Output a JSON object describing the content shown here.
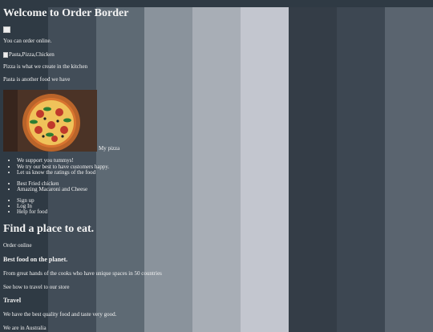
{
  "page": {
    "title": "Welcome to Order Border",
    "stripe_colors": [
      "#2f3a44",
      "#424d58",
      "#5e6a74",
      "#8a939c",
      "#a8aeb6",
      "#c3c6cf",
      "#343d47",
      "#3d4752",
      "#5a646f"
    ]
  },
  "intro": {
    "broken_image_icon": "broken-image-icon",
    "order_online_text": "You can order online.",
    "food_image_alt": "Pasta,Pizza,Chicken",
    "pizza_text": "Pizza is what we create in the kitchen",
    "pasta_text": "Pasta is another food we have",
    "pizza_caption": "My pizza"
  },
  "lists": {
    "support": [
      "We support you tummys!",
      "We try our best to have customers happy.",
      "Let us know the ratings of the food"
    ],
    "foods": [
      "Best Fried chicken",
      "Amazing Macaroni and Cheese"
    ],
    "links": [
      "Sign up",
      "Log In",
      "Help for food"
    ]
  },
  "section": {
    "heading": "Find a place to eat.",
    "order_online": "Order online",
    "best_food_heading": "Best food on the planet.",
    "cooks_text": "From great hands of the cooks who have unique spaces in 50 countries",
    "travel_text": "See how to travel to our store",
    "travel_heading": "Travel",
    "quality_text": "We have the best quality food and taste very good.",
    "location_text": "We are in Australia"
  }
}
